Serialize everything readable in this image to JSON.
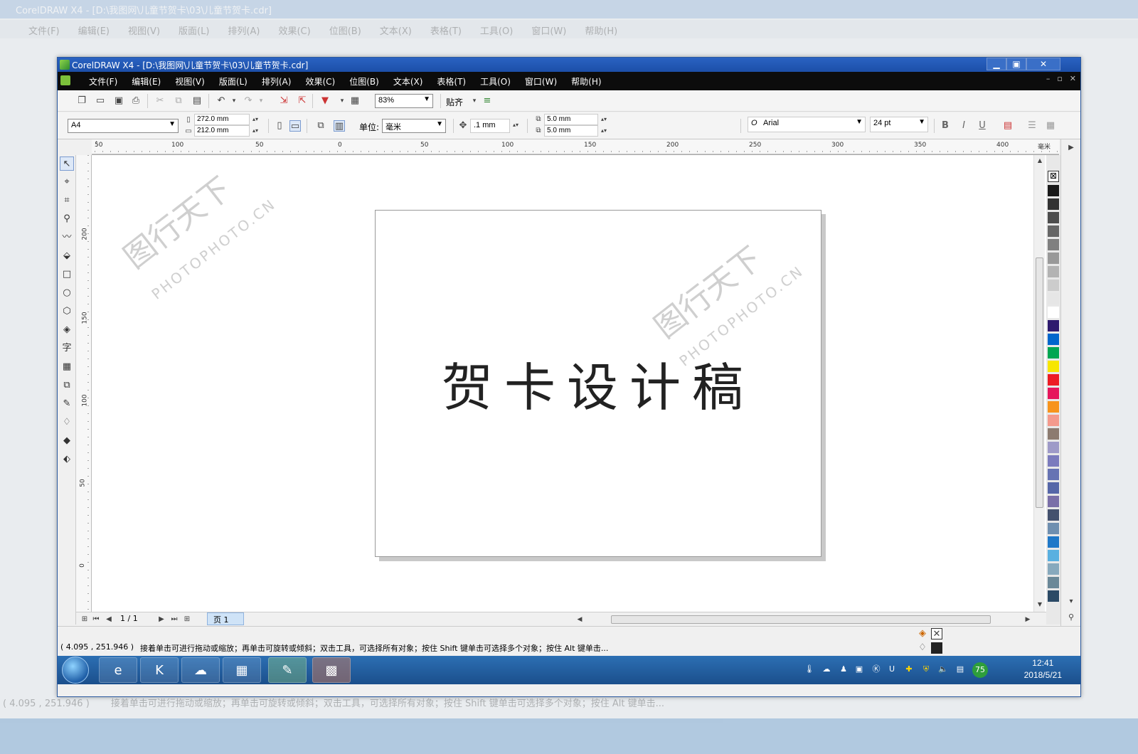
{
  "background": {
    "title": "CorelDRAW X4 - [D:\\我图网\\儿童节贺卡\\03\\儿童节贺卡.cdr]",
    "menu": [
      "文件(F)",
      "编辑(E)",
      "视图(V)",
      "版面(L)",
      "排列(A)",
      "效果(C)",
      "位图(B)",
      "文本(X)",
      "表格(T)",
      "工具(O)",
      "窗口(W)",
      "帮助(H)"
    ],
    "coords": "( 4.095 , 251.946 )",
    "status": "接着单击可进行拖动或缩放；再单击可旋转或倾斜；双击工具，可选择所有对象；按住 Shift 键单击可选择多个对象；按住 Alt 键单击..."
  },
  "window": {
    "title": "CorelDRAW X4 - [D:\\我图网\\儿童节贺卡\\03\\儿童节贺卡.cdr]",
    "controls": {
      "minimize": "▁",
      "maximize": "▣",
      "close": "✕"
    }
  },
  "menu": [
    "文件(F)",
    "编辑(E)",
    "视图(V)",
    "版面(L)",
    "排列(A)",
    "效果(C)",
    "位图(B)",
    "文本(X)",
    "表格(T)",
    "工具(O)",
    "窗口(W)",
    "帮助(H)"
  ],
  "toolbar": {
    "zoom": "83%",
    "snap_label": "贴齐"
  },
  "propertybar": {
    "page_size": "A4",
    "width": "272.0 mm",
    "height": "212.0 mm",
    "unit_label": "单位:",
    "unit": "毫米",
    "nudge": ".1 mm",
    "dup_x": "5.0 mm",
    "dup_y": "5.0 mm",
    "font_name": "Arial",
    "font_size": "24 pt"
  },
  "ruler": {
    "h_ticks": [
      "50",
      "100",
      "50",
      "0",
      "50",
      "100",
      "150",
      "200",
      "250",
      "300",
      "350",
      "400"
    ],
    "h_unit": "毫米",
    "v_ticks": [
      "200",
      "150",
      "100",
      "50",
      "0"
    ]
  },
  "canvas": {
    "text": "贺卡设计稿",
    "watermark_logo": "图行天下",
    "watermark_url": "PHOTOPHOTO.CN"
  },
  "pagenav": {
    "page_count": "1 / 1",
    "page_tab": "页 1"
  },
  "status": {
    "coords": "( 4.095 , 251.946 )",
    "message": "接着单击可进行拖动或缩放；再单击可旋转或倾斜；双击工具，可选择所有对象；按住 Shift 键单击可选择多个对象；按住 Alt 键单击..."
  },
  "taskbar": {
    "time": "12:41",
    "date": "2018/5/21",
    "badge": "75"
  },
  "colors": {
    "title_blue": "#1c4fa8",
    "menu_black": "#0c0c0c",
    "palette": [
      "#1a1a1a",
      "#333333",
      "#4d4d4d",
      "#666666",
      "#808080",
      "#999999",
      "#b3b3b3",
      "#cccccc",
      "#e6e6e6",
      "#ffffff",
      "#2e1a6e",
      "#0066cc",
      "#00a651",
      "#f7e600",
      "#ed1c24",
      "#e6175c",
      "#f7941d",
      "#f49a8c",
      "#8c7b70",
      "#9e9ac8",
      "#7b7bbd",
      "#6673b3",
      "#5566a8",
      "#7a6fa8",
      "#44516e",
      "#6f8fb0",
      "#1f78c8",
      "#59b0e0",
      "#87a9bd",
      "#6a8898",
      "#2b4a66"
    ]
  }
}
